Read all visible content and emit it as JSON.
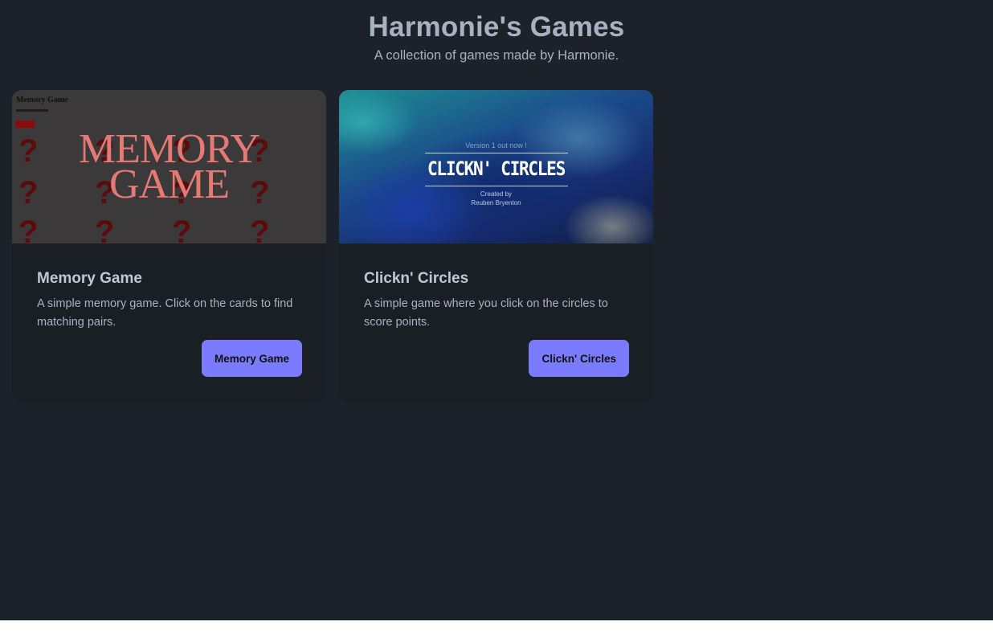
{
  "header": {
    "title": "Harmonie's Games",
    "subtitle": "A collection of games made by Harmonie."
  },
  "games": [
    {
      "title": "Memory Game",
      "description": "A simple memory game. Click on the cards to find matching pairs.",
      "button_label": "Memory Game",
      "thumbnail": {
        "small_title": "Memory Game",
        "line1": "MEMORY",
        "line2": "GAME",
        "card_glyph": "?"
      }
    },
    {
      "title": "Clickn' Circles",
      "description": "A simple game where you click on the circles to score points.",
      "button_label": "Clickn' Circles",
      "thumbnail": {
        "version_text": "Version 1 out now !",
        "title": "CLICKN' CIRCLES",
        "credit_line1": "Created by",
        "credit_line2": "Reuben Bryenton"
      }
    }
  ],
  "colors": {
    "background": "#1d2129",
    "card": "#1a1e25",
    "button": "#7b7bff",
    "text": "#a9b0bf"
  }
}
